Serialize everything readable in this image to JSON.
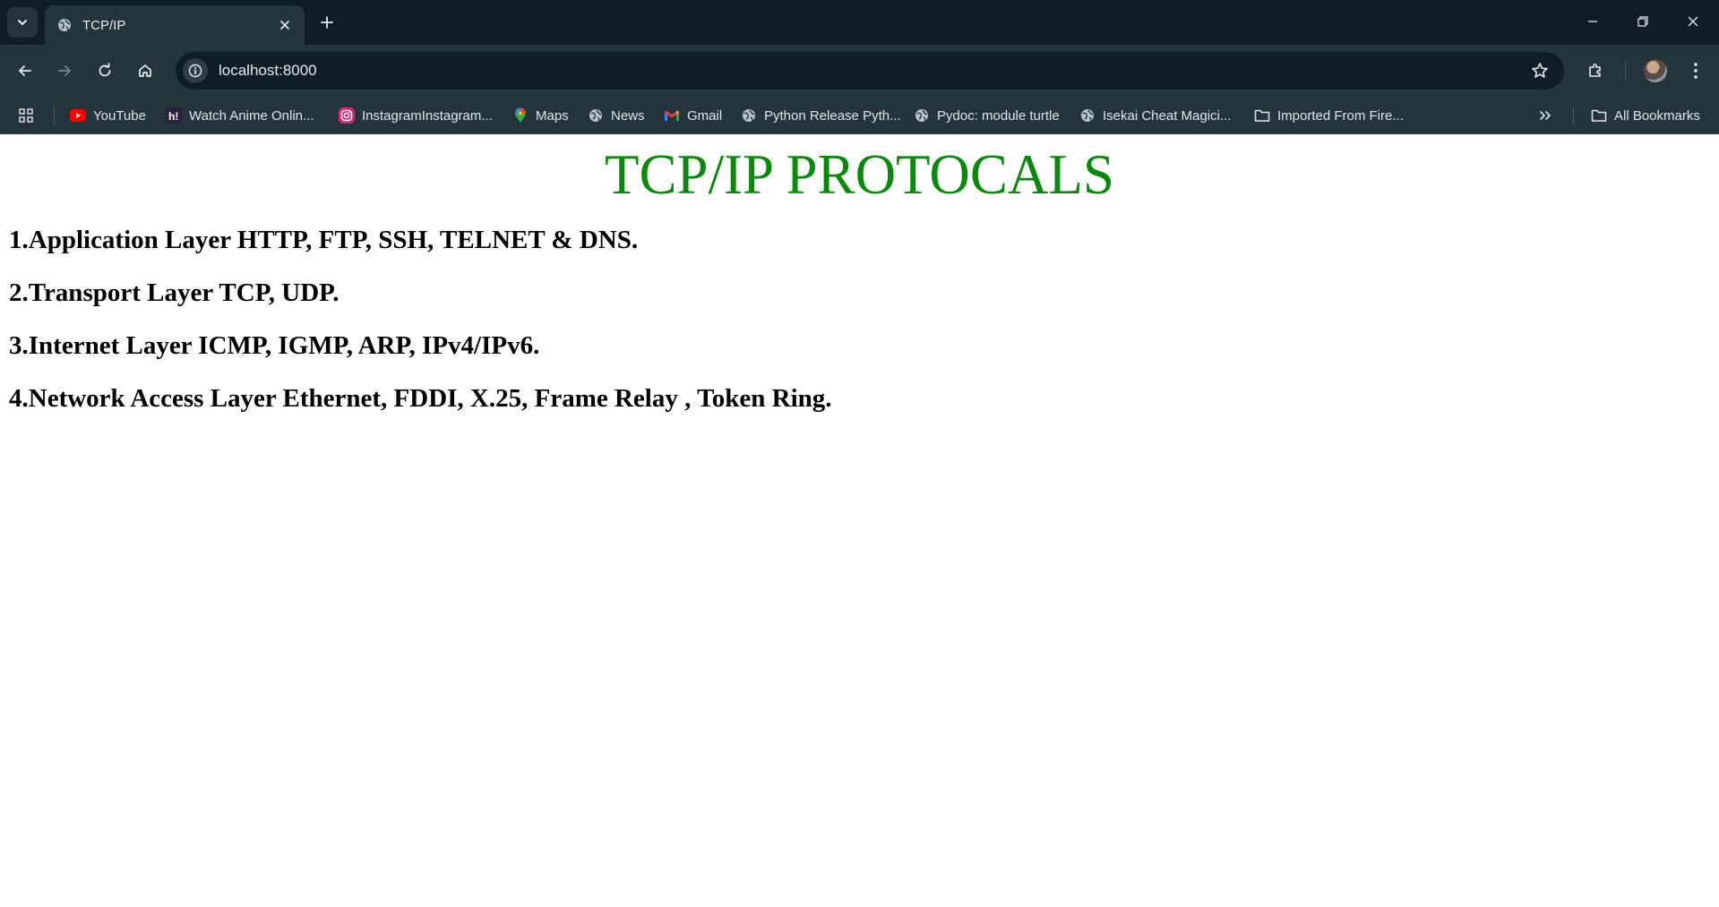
{
  "browser": {
    "tab": {
      "title": "TCP/IP"
    },
    "address_bar": {
      "url": "localhost:8000"
    },
    "bookmarks": [
      {
        "label": "YouTube",
        "icon": "youtube-icon"
      },
      {
        "label": "Watch Anime Onlin...",
        "icon": "hianime-icon"
      },
      {
        "label": "InstagramInstagram...",
        "icon": "instagram-icon"
      },
      {
        "label": "Maps",
        "icon": "maps-icon"
      },
      {
        "label": "News",
        "icon": "globe-icon"
      },
      {
        "label": "Gmail",
        "icon": "gmail-icon"
      },
      {
        "label": "Python Release Pyth...",
        "icon": "globe-icon"
      },
      {
        "label": "Pydoc: module turtle",
        "icon": "globe-icon"
      },
      {
        "label": "Isekai Cheat Magici...",
        "icon": "globe-icon"
      },
      {
        "label": "Imported From Fire...",
        "icon": "folder-icon"
      }
    ],
    "all_bookmarks_label": "All Bookmarks",
    "colors": {
      "frame": "#0f1e25",
      "toolbar": "#24353c"
    }
  },
  "page": {
    "title": "TCP/IP PROTOCALS",
    "title_color": "#0a8a0a",
    "layers": [
      "1.Application Layer HTTP, FTP, SSH, TELNET & DNS.",
      "2.Transport Layer TCP, UDP.",
      "3.Internet Layer ICMP, IGMP, ARP, IPv4/IPv6.",
      "4.Network Access Layer Ethernet, FDDI, X.25, Frame Relay , Token Ring."
    ]
  }
}
